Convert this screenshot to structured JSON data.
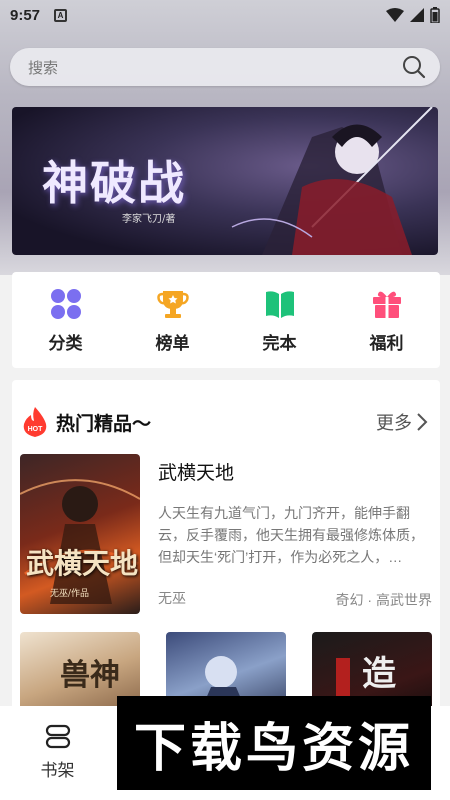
{
  "status_bar": {
    "time": "9:57",
    "a_label": "A"
  },
  "search": {
    "placeholder": "搜索"
  },
  "banner": {
    "title": "神破战",
    "author": "李家飞刀/著"
  },
  "categories": [
    {
      "label": "分类",
      "icon": "grid-icon",
      "color": "#7b6ff0"
    },
    {
      "label": "榜单",
      "icon": "trophy-icon",
      "color": "#f5a623"
    },
    {
      "label": "完本",
      "icon": "book-icon",
      "color": "#1ec27a"
    },
    {
      "label": "福利",
      "icon": "gift-icon",
      "color": "#ff4f7b"
    }
  ],
  "hot": {
    "badge": "HOT",
    "title": "热门精品〜",
    "more_label": "更多",
    "featured": {
      "title": "武横天地",
      "description": "人天生有九道气门，九门齐开，能伸手翻云，反手覆雨，他天生拥有最强修炼体质，但却天生‘死门’打开，作为必死之人，…",
      "author": "无巫",
      "tags": "奇幻 · 高武世界",
      "cover_text": "武横天地",
      "cover_subtext": "无巫/作品"
    },
    "more_covers": [
      {
        "cover_text": "兽神"
      },
      {
        "cover_text": ""
      },
      {
        "cover_text": "造"
      }
    ]
  },
  "bottom_nav": {
    "shelf_label": "书架"
  },
  "watermark": {
    "text": "下载鸟资源"
  },
  "colors": {
    "hot_accent": "#ff3b30",
    "background": "#f2f2f2"
  }
}
